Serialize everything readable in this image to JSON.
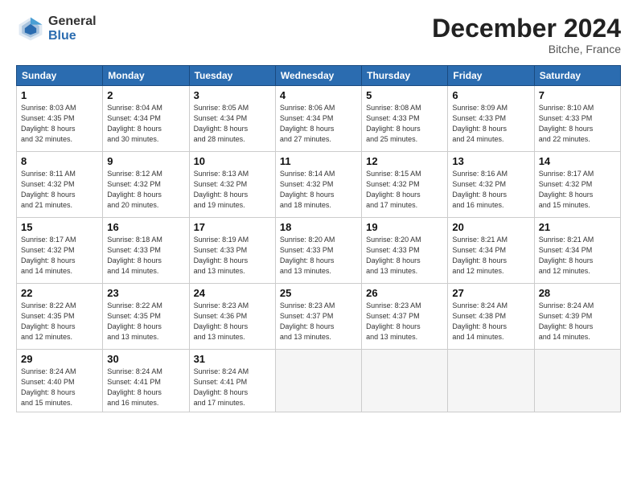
{
  "header": {
    "logo_general": "General",
    "logo_blue": "Blue",
    "month_title": "December 2024",
    "location": "Bitche, France"
  },
  "days_of_week": [
    "Sunday",
    "Monday",
    "Tuesday",
    "Wednesday",
    "Thursday",
    "Friday",
    "Saturday"
  ],
  "weeks": [
    [
      {
        "day": 1,
        "info": "Sunrise: 8:03 AM\nSunset: 4:35 PM\nDaylight: 8 hours\nand 32 minutes."
      },
      {
        "day": 2,
        "info": "Sunrise: 8:04 AM\nSunset: 4:34 PM\nDaylight: 8 hours\nand 30 minutes."
      },
      {
        "day": 3,
        "info": "Sunrise: 8:05 AM\nSunset: 4:34 PM\nDaylight: 8 hours\nand 28 minutes."
      },
      {
        "day": 4,
        "info": "Sunrise: 8:06 AM\nSunset: 4:34 PM\nDaylight: 8 hours\nand 27 minutes."
      },
      {
        "day": 5,
        "info": "Sunrise: 8:08 AM\nSunset: 4:33 PM\nDaylight: 8 hours\nand 25 minutes."
      },
      {
        "day": 6,
        "info": "Sunrise: 8:09 AM\nSunset: 4:33 PM\nDaylight: 8 hours\nand 24 minutes."
      },
      {
        "day": 7,
        "info": "Sunrise: 8:10 AM\nSunset: 4:33 PM\nDaylight: 8 hours\nand 22 minutes."
      }
    ],
    [
      {
        "day": 8,
        "info": "Sunrise: 8:11 AM\nSunset: 4:32 PM\nDaylight: 8 hours\nand 21 minutes."
      },
      {
        "day": 9,
        "info": "Sunrise: 8:12 AM\nSunset: 4:32 PM\nDaylight: 8 hours\nand 20 minutes."
      },
      {
        "day": 10,
        "info": "Sunrise: 8:13 AM\nSunset: 4:32 PM\nDaylight: 8 hours\nand 19 minutes."
      },
      {
        "day": 11,
        "info": "Sunrise: 8:14 AM\nSunset: 4:32 PM\nDaylight: 8 hours\nand 18 minutes."
      },
      {
        "day": 12,
        "info": "Sunrise: 8:15 AM\nSunset: 4:32 PM\nDaylight: 8 hours\nand 17 minutes."
      },
      {
        "day": 13,
        "info": "Sunrise: 8:16 AM\nSunset: 4:32 PM\nDaylight: 8 hours\nand 16 minutes."
      },
      {
        "day": 14,
        "info": "Sunrise: 8:17 AM\nSunset: 4:32 PM\nDaylight: 8 hours\nand 15 minutes."
      }
    ],
    [
      {
        "day": 15,
        "info": "Sunrise: 8:17 AM\nSunset: 4:32 PM\nDaylight: 8 hours\nand 14 minutes."
      },
      {
        "day": 16,
        "info": "Sunrise: 8:18 AM\nSunset: 4:33 PM\nDaylight: 8 hours\nand 14 minutes."
      },
      {
        "day": 17,
        "info": "Sunrise: 8:19 AM\nSunset: 4:33 PM\nDaylight: 8 hours\nand 13 minutes."
      },
      {
        "day": 18,
        "info": "Sunrise: 8:20 AM\nSunset: 4:33 PM\nDaylight: 8 hours\nand 13 minutes."
      },
      {
        "day": 19,
        "info": "Sunrise: 8:20 AM\nSunset: 4:33 PM\nDaylight: 8 hours\nand 13 minutes."
      },
      {
        "day": 20,
        "info": "Sunrise: 8:21 AM\nSunset: 4:34 PM\nDaylight: 8 hours\nand 12 minutes."
      },
      {
        "day": 21,
        "info": "Sunrise: 8:21 AM\nSunset: 4:34 PM\nDaylight: 8 hours\nand 12 minutes."
      }
    ],
    [
      {
        "day": 22,
        "info": "Sunrise: 8:22 AM\nSunset: 4:35 PM\nDaylight: 8 hours\nand 12 minutes."
      },
      {
        "day": 23,
        "info": "Sunrise: 8:22 AM\nSunset: 4:35 PM\nDaylight: 8 hours\nand 13 minutes."
      },
      {
        "day": 24,
        "info": "Sunrise: 8:23 AM\nSunset: 4:36 PM\nDaylight: 8 hours\nand 13 minutes."
      },
      {
        "day": 25,
        "info": "Sunrise: 8:23 AM\nSunset: 4:37 PM\nDaylight: 8 hours\nand 13 minutes."
      },
      {
        "day": 26,
        "info": "Sunrise: 8:23 AM\nSunset: 4:37 PM\nDaylight: 8 hours\nand 13 minutes."
      },
      {
        "day": 27,
        "info": "Sunrise: 8:24 AM\nSunset: 4:38 PM\nDaylight: 8 hours\nand 14 minutes."
      },
      {
        "day": 28,
        "info": "Sunrise: 8:24 AM\nSunset: 4:39 PM\nDaylight: 8 hours\nand 14 minutes."
      }
    ],
    [
      {
        "day": 29,
        "info": "Sunrise: 8:24 AM\nSunset: 4:40 PM\nDaylight: 8 hours\nand 15 minutes."
      },
      {
        "day": 30,
        "info": "Sunrise: 8:24 AM\nSunset: 4:41 PM\nDaylight: 8 hours\nand 16 minutes."
      },
      {
        "day": 31,
        "info": "Sunrise: 8:24 AM\nSunset: 4:41 PM\nDaylight: 8 hours\nand 17 minutes."
      },
      null,
      null,
      null,
      null
    ]
  ]
}
